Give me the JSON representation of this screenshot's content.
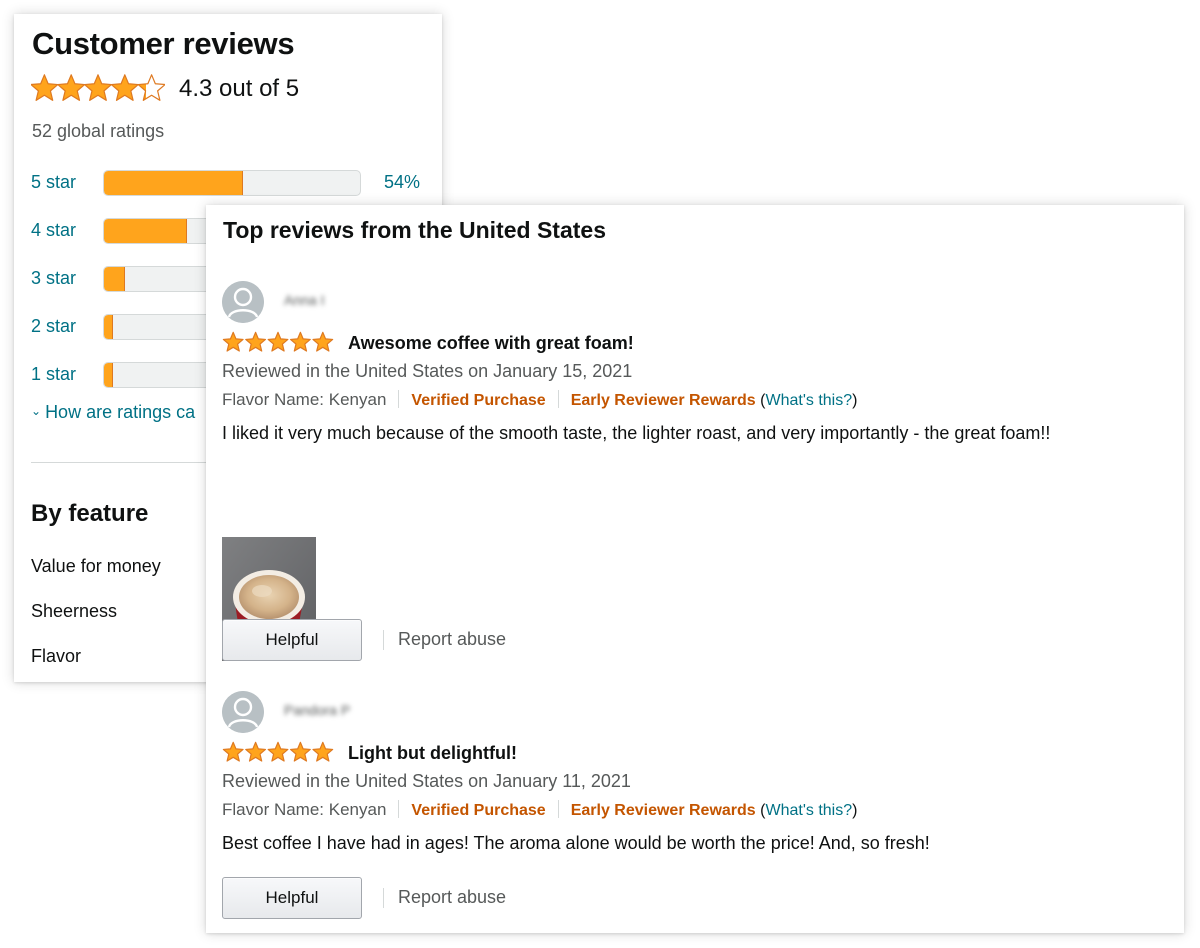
{
  "summary": {
    "title": "Customer reviews",
    "overall_stars": 4.3,
    "rating_text": "4.3 out of 5",
    "global_ratings": "52 global ratings",
    "histogram": [
      {
        "label": "5 star",
        "percent_text": "54%",
        "fraction": 0.54
      },
      {
        "label": "4 star",
        "percent_text": "",
        "fraction": 0.32
      },
      {
        "label": "3 star",
        "percent_text": "",
        "fraction": 0.08
      },
      {
        "label": "2 star",
        "percent_text": "",
        "fraction": 0.03
      },
      {
        "label": "1 star",
        "percent_text": "",
        "fraction": 0.03
      }
    ],
    "how_link": "How are ratings ca",
    "by_feature_title": "By feature",
    "features": [
      "Value for money",
      "Sheerness",
      "Flavor"
    ]
  },
  "reviews_panel": {
    "title": "Top reviews from the United States",
    "reviews": [
      {
        "reviewer": "Anna I",
        "stars": 5,
        "headline": "Awesome coffee with great foam!",
        "date": "Reviewed in the United States on January 15, 2021",
        "flavor": "Flavor Name: Kenyan",
        "verified": "Verified Purchase",
        "early": "Early Reviewer Rewards",
        "whats_this": "What's this?",
        "body": "I liked it very much because of the smooth taste, the lighter roast, and very importantly - the great foam!!",
        "helpful": "Helpful",
        "report": "Report abuse"
      },
      {
        "reviewer": "Pandora P",
        "stars": 5,
        "headline": "Light but delightful!",
        "date": "Reviewed in the United States on January 11, 2021",
        "flavor": "Flavor Name: Kenyan",
        "verified": "Verified Purchase",
        "early": "Early Reviewer Rewards",
        "whats_this": "What's this?",
        "body": "Best coffee I have had in ages! The aroma alone would be worth the price! And, so fresh!",
        "helpful": "Helpful",
        "report": "Report abuse"
      }
    ]
  },
  "colors": {
    "star_fill": "#ffa41c",
    "star_stroke": "#de7921",
    "link": "#007185",
    "badge": "#c45500",
    "secondary_text": "#565959"
  }
}
